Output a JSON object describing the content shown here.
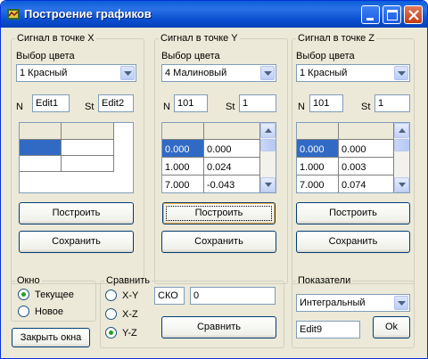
{
  "window": {
    "title": "Построение графиков"
  },
  "x_panel": {
    "legend": "Сигнал в точке X",
    "color_label": "Выбор цвета",
    "color_value": "1 Красный",
    "n_label": "N",
    "n_value": "Edit1",
    "st_label": "St",
    "st_value": "Edit2",
    "build_label": "Построить",
    "save_label": "Сохранить"
  },
  "y_panel": {
    "legend": "Сигнал в точке Y",
    "color_label": "Выбор цвета",
    "color_value": "4 Малиновый",
    "n_label": "N",
    "n_value": "101",
    "st_label": "St",
    "st_value": "1",
    "rows": [
      [
        "0.000",
        "0.000"
      ],
      [
        "1.000",
        "0.024"
      ],
      [
        "7.000",
        "-0.043"
      ]
    ],
    "build_label": "Построить",
    "save_label": "Сохранить"
  },
  "z_panel": {
    "legend": "Сигнал в точке Z",
    "color_label": "Выбор цвета",
    "color_value": "1 Красный",
    "n_label": "N",
    "n_value": "101",
    "st_label": "St",
    "st_value": "1",
    "rows": [
      [
        "0.000",
        "0.000"
      ],
      [
        "1.000",
        "0.003"
      ],
      [
        "7.000",
        "0.074"
      ]
    ],
    "build_label": "Построить",
    "save_label": "Сохранить"
  },
  "window_group": {
    "legend": "Окно",
    "options": [
      "Текущее",
      "Новое"
    ],
    "selected": "Текущее",
    "close_label": "Закрыть окна"
  },
  "compare_group": {
    "legend": "Сравнить",
    "options": [
      "X-Y",
      "X-Z",
      "Y-Z"
    ],
    "selected": "Y-Z",
    "sko_label": "СКО",
    "sko_value": "0",
    "compare_label": "Сравнить"
  },
  "indicators": {
    "legend": "Показатели",
    "select_value": "Интегральный",
    "edit_value": "Edit9",
    "ok_label": "Ok"
  },
  "colors": {
    "selection": "#316ac5",
    "titlebar": "#0a5fd8",
    "panel": "#ece9d8"
  }
}
